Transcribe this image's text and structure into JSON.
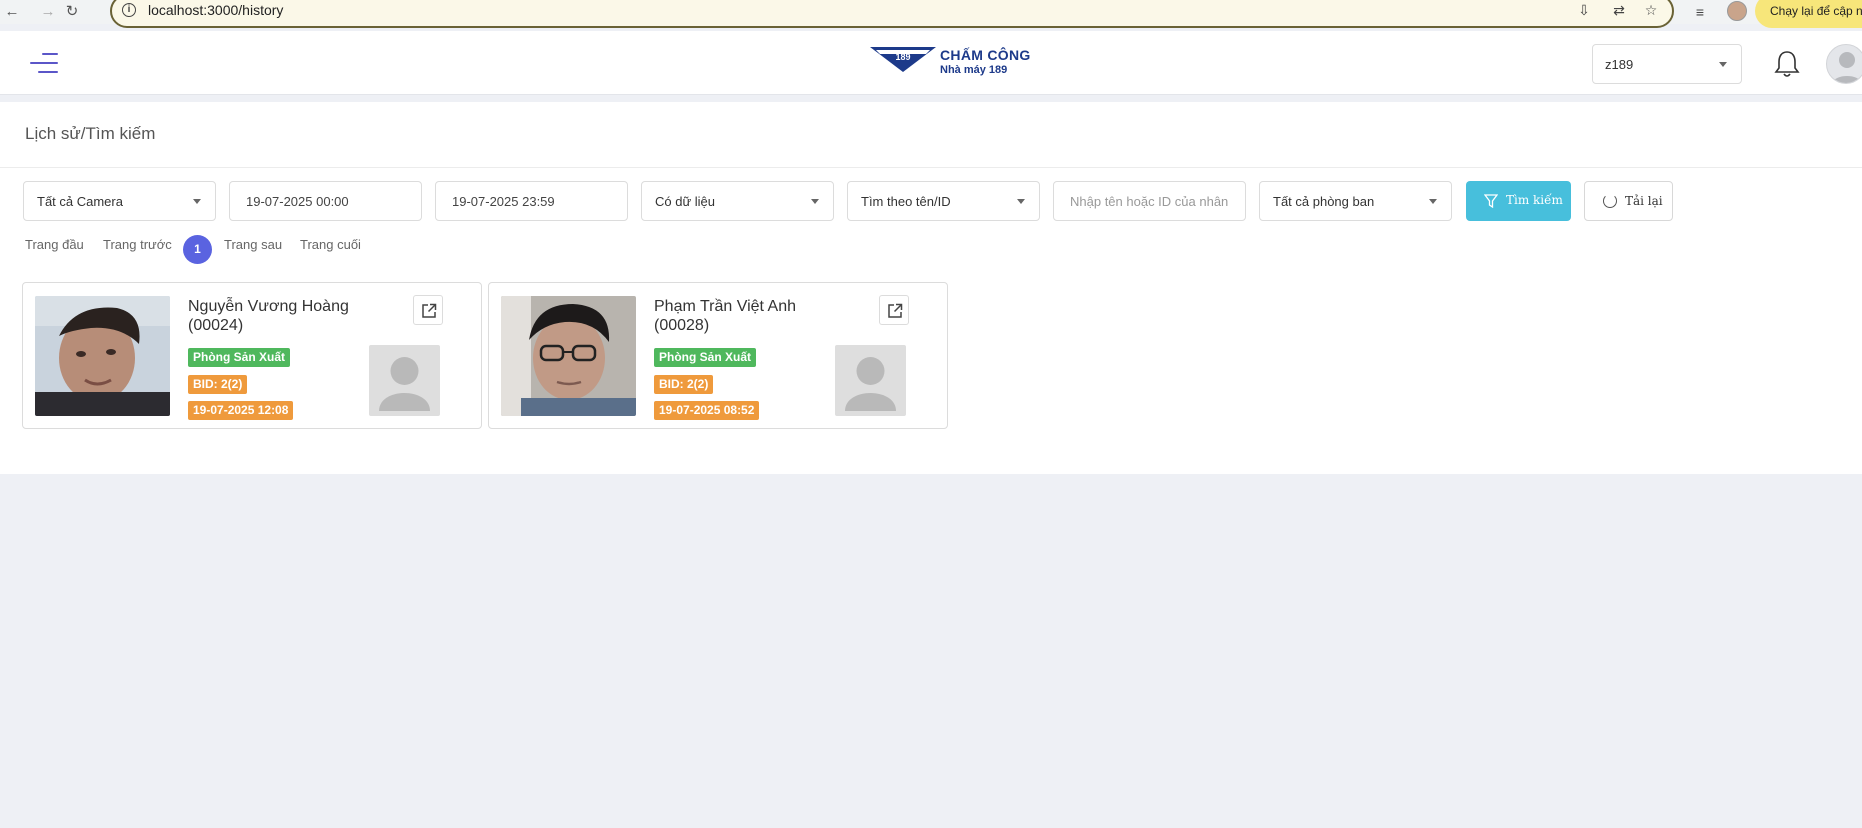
{
  "browser": {
    "url": "localhost:3000/history",
    "update_label": "Chạy lại để cập nhật"
  },
  "header": {
    "logo_title": "CHẤM CÔNG",
    "logo_subtitle": "Nhà máy 189",
    "logo_mark": "189",
    "org_select_value": "z189"
  },
  "page": {
    "title": "Lịch sử/Tìm kiếm"
  },
  "filters": {
    "camera": "Tất cả Camera",
    "date_from": "19-07-2025 00:00",
    "date_to": "19-07-2025 23:59",
    "data_filter": "Có dữ liệu",
    "search_mode": "Tìm theo tên/ID",
    "search_placeholder": "Nhập tên hoặc ID của nhân",
    "department": "Tất cả phòng ban",
    "search_button": "Tìm kiếm",
    "reload_button": "Tải lại"
  },
  "pagination": {
    "first": "Trang đầu",
    "prev": "Trang trước",
    "current": "1",
    "next": "Trang sau",
    "last": "Trang cuối"
  },
  "records": [
    {
      "name": "Nguyễn Vương Hoàng (00024)",
      "department": "Phòng Sản Xuất",
      "bid": "BID: 2(2)",
      "time": "19-07-2025 12:08"
    },
    {
      "name": "Phạm Trần Việt Anh (00028)",
      "department": "Phòng Sản Xuất",
      "bid": "BID: 2(2)",
      "time": "19-07-2025 08:52"
    }
  ],
  "colors": {
    "accent": "#5b56c8",
    "search_button": "#47bfdc",
    "badge_green": "#4fb85d",
    "badge_orange": "#ef9a3c",
    "page_active": "#5a63e0"
  }
}
